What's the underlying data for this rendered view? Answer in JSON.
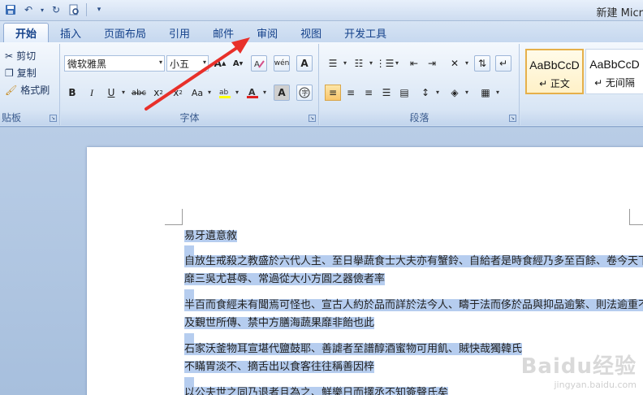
{
  "window": {
    "title": "新建 Micr"
  },
  "tabs": [
    "开始",
    "插入",
    "页面布局",
    "引用",
    "邮件",
    "审阅",
    "视图",
    "开发工具"
  ],
  "clipboard": {
    "cut": "剪切",
    "copy": "复制",
    "format_painter": "格式刷",
    "group_label": "贴板"
  },
  "font": {
    "name": "微软雅黑",
    "size": "小五",
    "group_label": "字体"
  },
  "paragraph": {
    "group_label": "段落"
  },
  "styles": [
    {
      "sample": "AaBbCcD",
      "name": "↵ 正文"
    },
    {
      "sample": "AaBbCcD",
      "name": "↵ 无间隔"
    }
  ],
  "document": {
    "paragraphs": [
      "易牙遺意敘",
      "自放生戒殺之教盛於六代人主、至日擧蔬食士大夫亦有蟹鈴、自給者是時食經乃多至百餘、卷今天下號極",
      "靡三吳尤甚辱、常過從大小方圓之器儉者率",
      "半百而食經未有聞焉可怪也、宣古人約於品而詳於法今人、疇于法而侈於品與抑品逾繁、則法逾重不傳與",
      "及覲世所傳、禁中方膳海蔬果靡非飴也此",
      "石家沃釜物耳宣堪代鹽鼓耶、善謔者至譜醇酒蜜物可用飢、賊快哉獨韓氏",
      "不瞞胃淡不、摘舌出以食客往往稱善因梓",
      "以公夫世之同乃退者且為之、鮮樂日而擇丞不知簽聲氏矣"
    ]
  },
  "watermark": {
    "brand": "Baidu经验",
    "url": "jingyan.baidu.com"
  }
}
